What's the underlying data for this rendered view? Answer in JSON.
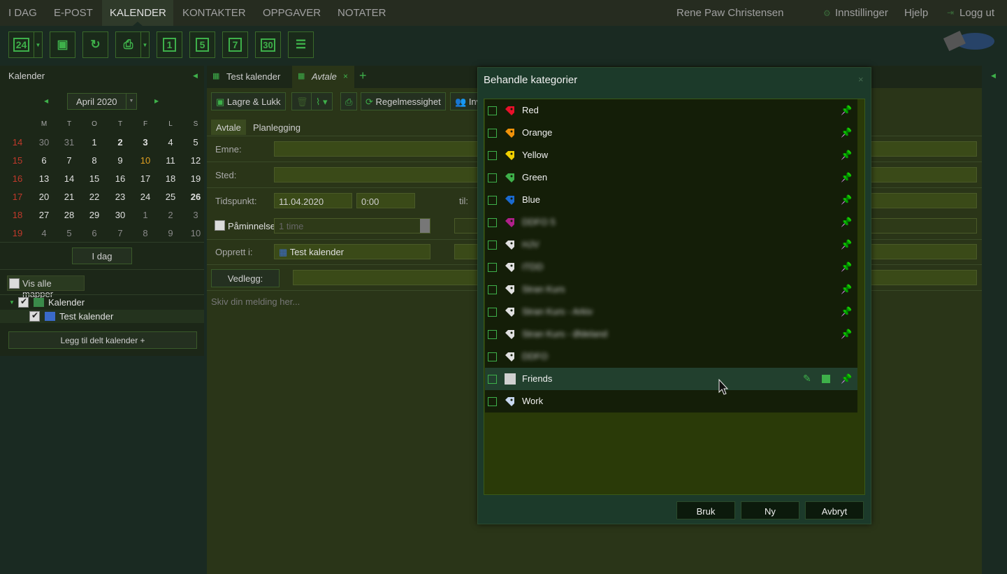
{
  "nav": {
    "items": [
      "I DAG",
      "E-POST",
      "KALENDER",
      "KONTAKTER",
      "OPPGAVER",
      "NOTATER"
    ],
    "user": "Rene Paw Christensen",
    "settings": "Innstillinger",
    "help": "Hjelp",
    "logout": "Logg ut"
  },
  "toolbar": {
    "cal_day_icon": "24",
    "view_1": "1",
    "view_5": "5",
    "view_7": "7",
    "view_30": "30"
  },
  "sidebar": {
    "title": "Kalender",
    "month": "April 2020",
    "day_headers": [
      "M",
      "T",
      "O",
      "T",
      "F",
      "L",
      "S"
    ],
    "weeks": [
      {
        "wk": "14",
        "days": [
          "30",
          "31",
          "1",
          "2",
          "3",
          "4",
          "5"
        ]
      },
      {
        "wk": "15",
        "days": [
          "6",
          "7",
          "8",
          "9",
          "10",
          "11",
          "12"
        ]
      },
      {
        "wk": "16",
        "days": [
          "13",
          "14",
          "15",
          "16",
          "17",
          "18",
          "19"
        ]
      },
      {
        "wk": "17",
        "days": [
          "20",
          "21",
          "22",
          "23",
          "24",
          "25",
          "26"
        ]
      },
      {
        "wk": "18",
        "days": [
          "27",
          "28",
          "29",
          "30",
          "1",
          "2",
          "3"
        ]
      },
      {
        "wk": "19",
        "days": [
          "4",
          "5",
          "6",
          "7",
          "8",
          "9",
          "10"
        ]
      }
    ],
    "today_btn": "I dag",
    "show_all": "Vis alle mapper",
    "tree_root": "Kalender",
    "tree_child": "Test kalender",
    "add_shared": "Legg til delt kalender +"
  },
  "tabs": {
    "tab1": "Test kalender",
    "tab2": "Avtale",
    "add": "+"
  },
  "editor": {
    "save_close": "Lagre & Lukk",
    "recurrence": "Regelmessighet",
    "invite": "Inv",
    "subtab1": "Avtale",
    "subtab2": "Planlegging",
    "subject_label": "Emne:",
    "location_label": "Sted:",
    "time_label": "Tidspunkt:",
    "date": "11.04.2020",
    "time": "0:00",
    "to_label": "til:",
    "reminder_label": "Påminnelse:",
    "reminder_value": "1 time",
    "created_in_label": "Opprett i:",
    "created_in_value": "Test kalender",
    "attach_btn": "Vedlegg:",
    "body_placeholder": "Skiv din melding her..."
  },
  "dialog": {
    "title": "Behandle kategorier",
    "close": "×",
    "categories": [
      {
        "label": "Red",
        "color": "#e8102a",
        "pinned": true
      },
      {
        "label": "Orange",
        "color": "#f0920a",
        "pinned": true
      },
      {
        "label": "Yellow",
        "color": "#f0d000",
        "pinned": true
      },
      {
        "label": "Green",
        "color": "#3eb04a",
        "pinned": true
      },
      {
        "label": "Blue",
        "color": "#1a6ad0",
        "pinned": true
      },
      {
        "label": "DDFO 5",
        "color": "#b0208a",
        "pinned": true
      },
      {
        "label": "HJV",
        "color": "#e0e0e0",
        "pinned": true
      },
      {
        "label": "ITDD",
        "color": "#e0e0e0",
        "pinned": true
      },
      {
        "label": "Stran Kurs",
        "color": "#e0e0e0",
        "pinned": true
      },
      {
        "label": "Stran Kurs - Arkiv",
        "color": "#e0e0e0",
        "pinned": true
      },
      {
        "label": "Stran Kurs - Ødeland",
        "color": "#e0e0e0",
        "pinned": true
      },
      {
        "label": "DDFO",
        "color": "#e0e0e0",
        "pinned": false
      },
      {
        "label": "Friends",
        "color": "#d0d0d0",
        "pinned": false
      },
      {
        "label": "Work",
        "color": "#c8d8f0",
        "pinned": false
      }
    ],
    "apply": "Bruk",
    "new": "Ny",
    "cancel": "Avbryt"
  }
}
